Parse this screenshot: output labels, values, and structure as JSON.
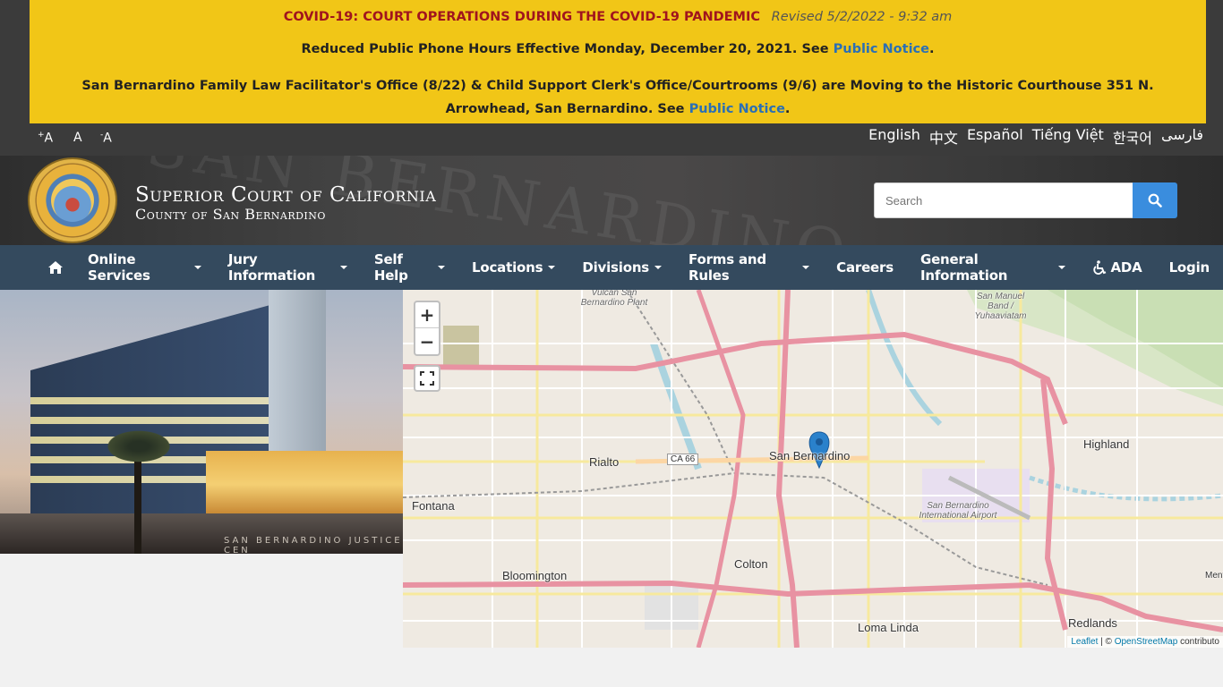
{
  "alert": {
    "covid_title": "COVID-19: COURT OPERATIONS DURING THE COVID-19 PANDEMIC",
    "revised": "Revised 5/2/2022 - 9:32 am",
    "phone_text": "Reduced Public Phone Hours Effective Monday, December 20, 2021. See ",
    "phone_link": "Public Notice",
    "moving_text": "San Bernardino Family Law Facilitator's Office (8/22) & Child Support Clerk's Office/Courtrooms (9/6) are Moving to the Historic Courthouse 351 N. Arrowhead, San Bernardino. See ",
    "moving_link": "Public Notice",
    "period": "."
  },
  "font_sizer": {
    "increase": "A",
    "normal": "A",
    "decrease": "A",
    "plus": "+",
    "minus": "-"
  },
  "languages": [
    "English",
    "中文",
    "Español",
    "Tiếng Việt",
    "한국어",
    "فارسی"
  ],
  "header": {
    "title": "Superior Court of California",
    "subtitle": "County of San Bernardino",
    "bg_text": "SAN BERNARDINO"
  },
  "search": {
    "placeholder": "Search"
  },
  "nav": {
    "items": [
      {
        "label": "Online Services",
        "dropdown": true
      },
      {
        "label": "Jury Information",
        "dropdown": true
      },
      {
        "label": "Self Help",
        "dropdown": true
      },
      {
        "label": "Locations",
        "dropdown": true
      },
      {
        "label": "Divisions",
        "dropdown": true
      },
      {
        "label": "Forms and Rules",
        "dropdown": true
      },
      {
        "label": "Careers",
        "dropdown": false
      },
      {
        "label": "General Information",
        "dropdown": true
      },
      {
        "label": "ADA",
        "dropdown": false
      },
      {
        "label": "Login",
        "dropdown": false
      }
    ]
  },
  "photo": {
    "sign": "SAN BERNARDINO JUSTICE CEN"
  },
  "map": {
    "zoom_in": "+",
    "zoom_out": "−",
    "labels": {
      "san_bernardino": "San Bernardino",
      "rialto": "Rialto",
      "fontana": "Fontana",
      "highland": "Highland",
      "colton": "Colton",
      "bloomington": "Bloomington",
      "loma_linda": "Loma Linda",
      "redlands": "Redlands",
      "vulcan": "Vulcan San Bernardino Plant",
      "san_manuel": "San Manuel Band / Yuhaaviatam",
      "airport": "San Bernardino International Airport",
      "ca66": "CA 66",
      "mentone": "Ment"
    },
    "attribution": {
      "leaflet": "Leaflet",
      "sep": " | © ",
      "osm": "OpenStreetMap",
      "contrib": " contributo"
    }
  },
  "colors": {
    "alert_bg": "#f1c617",
    "covid_red": "#a0141e",
    "link_blue": "#2a6fb5",
    "nav_bg": "#344a5e",
    "search_btn": "#3a8dde"
  }
}
